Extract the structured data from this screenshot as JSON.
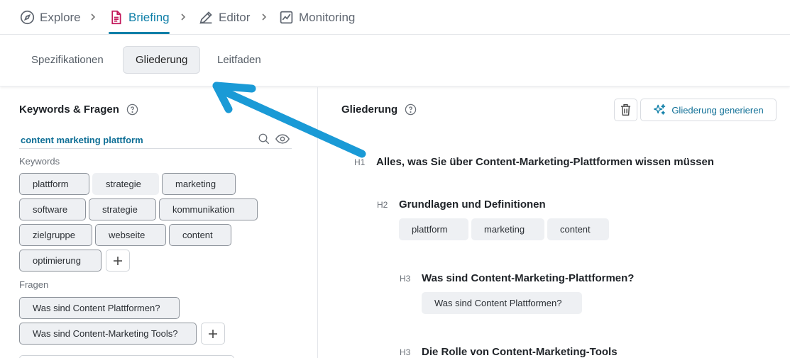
{
  "topnav": {
    "items": [
      {
        "label": "Explore",
        "icon": "compass-icon",
        "active": false
      },
      {
        "label": "Briefing",
        "icon": "document-icon",
        "active": true
      },
      {
        "label": "Editor",
        "icon": "pencil-icon",
        "active": false
      },
      {
        "label": "Monitoring",
        "icon": "chart-icon",
        "active": false
      }
    ],
    "accent_color": "#0f7fa8",
    "briefing_icon_color": "#c2185b"
  },
  "subtabs": {
    "items": [
      {
        "label": "Spezifikationen",
        "active": false
      },
      {
        "label": "Gliederung",
        "active": true
      },
      {
        "label": "Leitfaden",
        "active": false
      }
    ]
  },
  "left_panel": {
    "title": "Keywords & Fragen",
    "search": {
      "value": "content marketing plattform",
      "placeholder": ""
    },
    "keywords_label": "Keywords",
    "keyword_rows": [
      [
        "plattform",
        "strategie",
        "marketing"
      ],
      [
        "software",
        "strategie",
        "kommunikation"
      ],
      [
        "zielgruppe",
        "webseite",
        "content"
      ],
      [
        "optimierung"
      ]
    ],
    "questions_label": "Fragen",
    "questions": [
      "Was sind Content Plattformen?",
      "Was sind Content-Marketing Tools?"
    ]
  },
  "right_panel": {
    "title": "Gliederung",
    "generate_label": "Gliederung generieren",
    "outline": [
      {
        "level": "H1",
        "text": "Alles, was Sie über Content-Marketing-Plattformen wissen müssen",
        "tags": []
      },
      {
        "level": "H2",
        "text": "Grundlagen und Definitionen",
        "tags": [
          "plattform",
          "marketing",
          "content"
        ]
      },
      {
        "level": "H3",
        "text": "Was sind Content-Marketing-Plattformen?",
        "tags": [
          "Was sind Content Plattformen?"
        ]
      },
      {
        "level": "H3",
        "text": "Die Rolle von Content-Marketing-Tools",
        "tags": []
      }
    ]
  },
  "annotation": {
    "arrow_color": "#1a9ad6"
  }
}
